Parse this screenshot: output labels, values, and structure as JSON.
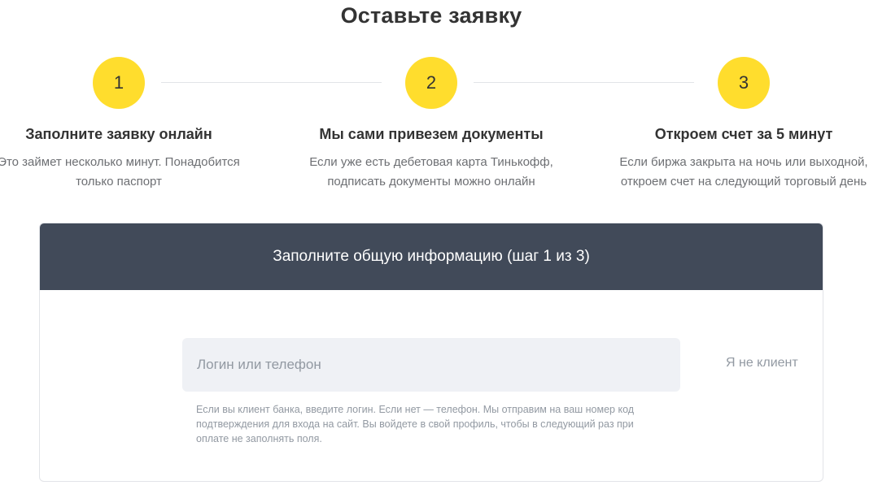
{
  "page": {
    "title": "Оставьте заявку"
  },
  "steps": [
    {
      "number": "1",
      "title": "Заполните заявку онлайн",
      "description_line1": "Это займет несколько минут. Понадобится",
      "description_line2": "только паспорт"
    },
    {
      "number": "2",
      "title": "Мы сами привезем документы",
      "description_line1": "Если уже есть дебетовая карта Тинькофф,",
      "description_line2": "подписать документы можно онлайн"
    },
    {
      "number": "3",
      "title": "Откроем счет за 5 минут",
      "description_line1": "Если биржа закрыта на ночь или выходной,",
      "description_line2": "откроем счет на следующий торговый день"
    }
  ],
  "form": {
    "header": "Заполните общую информацию (шаг 1 из 3)",
    "login_placeholder": "Логин или телефон",
    "login_value": "",
    "not_client_link": "Я не клиент",
    "hint_line1": "Если вы клиент банка, введите логин. Если нет — телефон. Мы отправим на ваш номер код",
    "hint_line2": "подтверждения для входа на сайт. Вы войдете в свой профиль, чтобы в следующий раз при",
    "hint_line3": "оплате не заполнять поля."
  },
  "colors": {
    "accent_yellow": "#ffdd2d",
    "header_bg": "#414a59",
    "input_bg": "#eff1f5",
    "muted_text": "#9299a2"
  }
}
